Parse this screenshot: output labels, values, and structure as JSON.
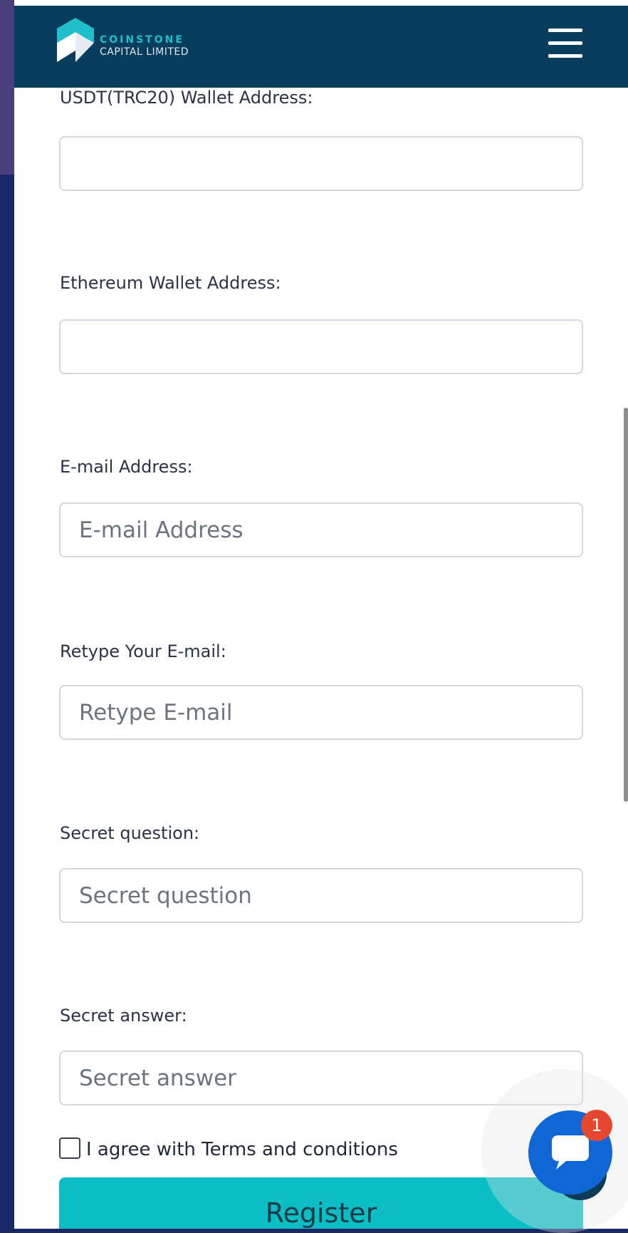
{
  "header": {
    "brand_line1": "COINSTONE",
    "brand_line2": "CAPITAL LIMITED",
    "menu_icon": "hamburger-menu-icon"
  },
  "form": {
    "fields": [
      {
        "label": "USDT(TRC20) Wallet Address:",
        "placeholder": "",
        "value": ""
      },
      {
        "label": "Ethereum Wallet Address:",
        "placeholder": "",
        "value": ""
      },
      {
        "label": "E-mail Address:",
        "placeholder": "E-mail Address",
        "value": ""
      },
      {
        "label": "Retype Your E-mail:",
        "placeholder": "Retype E-mail",
        "value": ""
      },
      {
        "label": "Secret question:",
        "placeholder": "Secret question",
        "value": ""
      },
      {
        "label": "Secret answer:",
        "placeholder": "Secret answer",
        "value": ""
      }
    ],
    "terms_label": "I agree with Terms and conditions",
    "terms_checked": false,
    "register_label": "Register"
  },
  "chat": {
    "icon": "chat-bubble-icon",
    "badge": "1"
  },
  "colors": {
    "header_bg": "#083d5e",
    "accent": "#0bbec4",
    "chat_button": "#1166d6",
    "badge": "#e5482f"
  }
}
